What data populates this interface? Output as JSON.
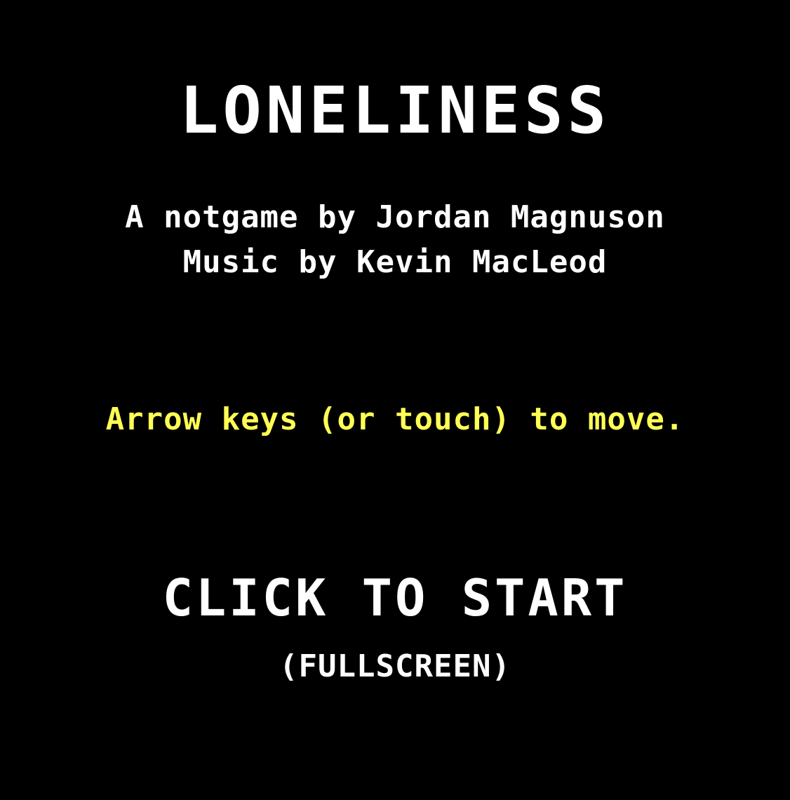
{
  "title": "LONELINESS",
  "credits": {
    "author_line": "A notgame by Jordan Magnuson",
    "music_line": "Music by Kevin MacLeod"
  },
  "instructions": "Arrow keys (or touch) to move.",
  "start": {
    "label": "CLICK TO START",
    "sublabel": "(FULLSCREEN)"
  },
  "colors": {
    "background": "#000000",
    "text": "#ffffff",
    "instructions": "#ffff55"
  }
}
